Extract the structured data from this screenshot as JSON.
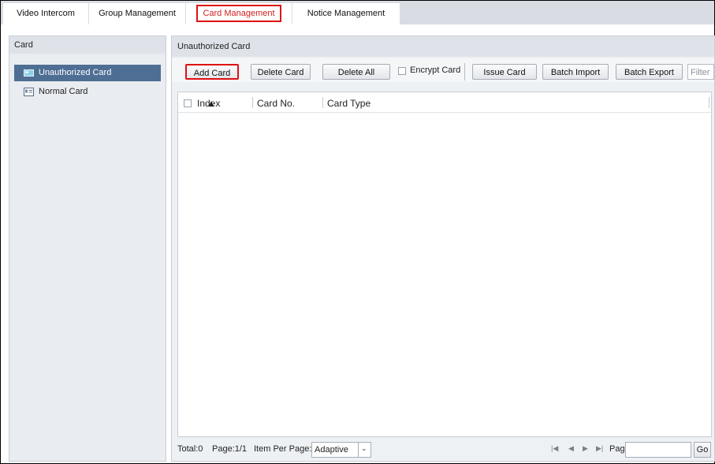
{
  "tabs": [
    {
      "label": "Video Intercom"
    },
    {
      "label": "Group Management"
    },
    {
      "label": "Card Management"
    },
    {
      "label": "Notice Management"
    }
  ],
  "left_panel": {
    "title": "Card",
    "items": [
      {
        "label": "Unauthorized Card",
        "icon": "card-icon",
        "selected": true
      },
      {
        "label": "Normal Card",
        "icon": "id-card-icon",
        "selected": false
      }
    ]
  },
  "right_panel": {
    "title": "Unauthorized Card",
    "toolbar": {
      "add_card": "Add Card",
      "delete_card": "Delete Card",
      "delete_all": "Delete All",
      "encrypt_card": "Encrypt Card",
      "issue_card": "Issue Card",
      "batch_import": "Batch Import",
      "batch_export": "Batch Export",
      "filter_placeholder": "Filter"
    },
    "table": {
      "columns": [
        "Index",
        "Card No.",
        "Card Type"
      ],
      "rows": []
    },
    "footer": {
      "total": "Total:0",
      "page_info": "Page:1/1",
      "items_per_page_label": "Item Per Page:",
      "items_per_page_value": "Adaptive",
      "page_label": "Page",
      "go": "Go"
    }
  },
  "colors": {
    "highlight_red": "#e01010",
    "selected_item_bg": "#4f6e94",
    "tabbar_bg": "#d9dde3"
  }
}
